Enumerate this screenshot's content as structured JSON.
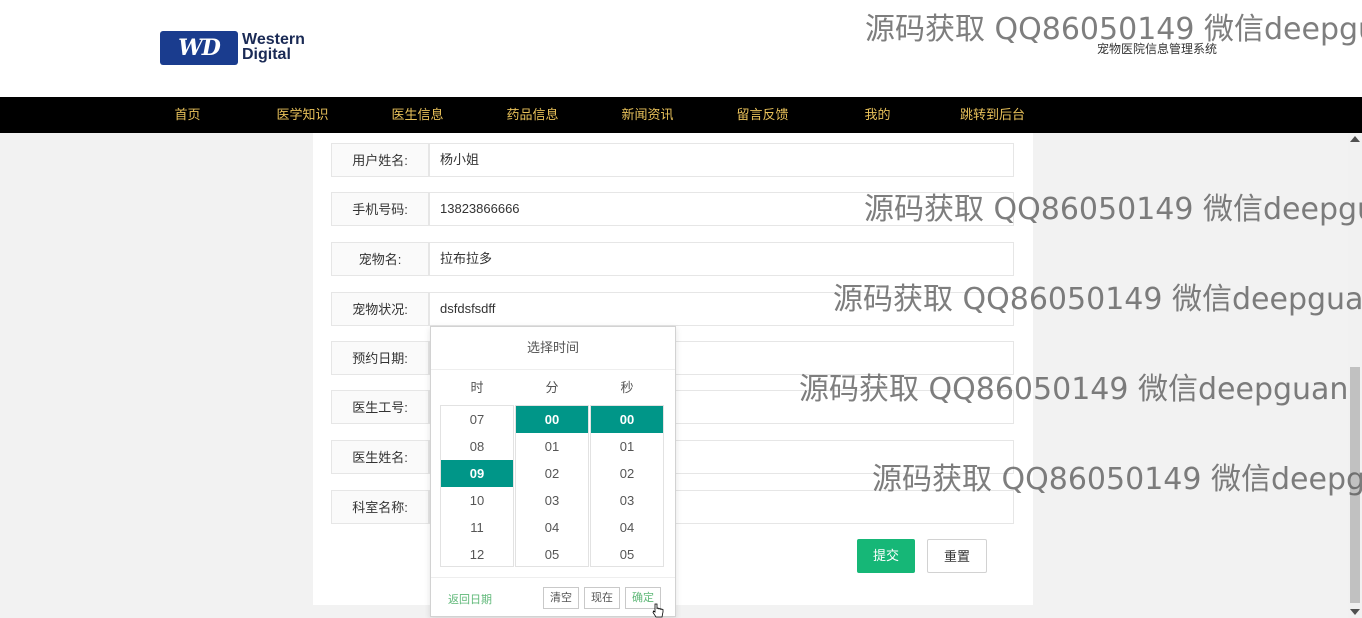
{
  "header": {
    "logo_text": "Western Digital",
    "logo_badge": "WD",
    "site_title": "宠物医院信息管理系统"
  },
  "nav": {
    "items": [
      "首页",
      "医学知识",
      "医生信息",
      "药品信息",
      "新闻资讯",
      "留言反馈",
      "我的",
      "跳转到后台"
    ]
  },
  "form": {
    "fields": [
      {
        "label": "用户姓名:",
        "value": "杨小姐"
      },
      {
        "label": "手机号码:",
        "value": "13823866666"
      },
      {
        "label": "宠物名:",
        "value": "拉布拉多"
      },
      {
        "label": "宠物状况:",
        "value": "dsfdsfsdff"
      },
      {
        "label": "预约日期:",
        "value": ""
      },
      {
        "label": "医生工号:",
        "value": ""
      },
      {
        "label": "医生姓名:",
        "value": ""
      },
      {
        "label": "科室名称:",
        "value": ""
      }
    ],
    "submit_label": "提交",
    "reset_label": "重置"
  },
  "time_picker": {
    "title": "选择时间",
    "col_hour": "时",
    "col_minute": "分",
    "col_second": "秒",
    "hours": [
      "07",
      "08",
      "09",
      "10",
      "11",
      "12"
    ],
    "minutes": [
      "00",
      "01",
      "02",
      "03",
      "04",
      "05"
    ],
    "seconds": [
      "00",
      "01",
      "02",
      "03",
      "04",
      "05"
    ],
    "selected_hour": "09",
    "selected_minute": "00",
    "selected_second": "00",
    "back_label": "返回日期",
    "clear_label": "清空",
    "now_label": "现在",
    "confirm_label": "确定"
  },
  "watermark": {
    "text": "源码获取 QQ86050149 微信deepguan"
  },
  "colors": {
    "nav_bg": "#000000",
    "nav_text": "#e8c15a",
    "accent": "#009688",
    "submit": "#16b777"
  }
}
